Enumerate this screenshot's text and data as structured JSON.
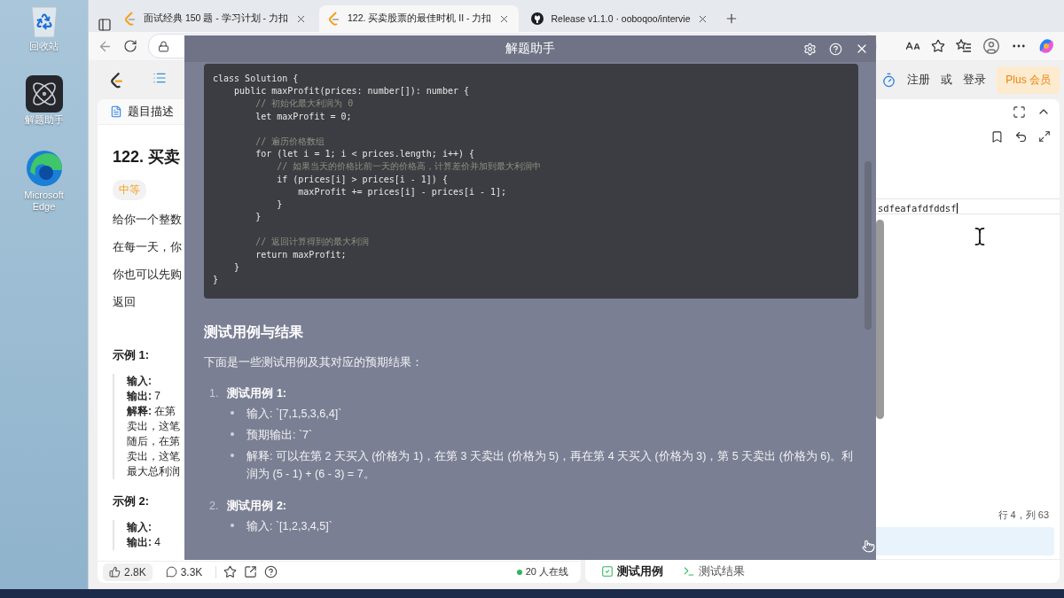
{
  "desktop_icons": [
    {
      "kind": "recycle",
      "label": "回收站"
    },
    {
      "kind": "atom",
      "label": "解题助手"
    },
    {
      "kind": "edge",
      "label": "Microsoft Edge"
    }
  ],
  "browser": {
    "tabs": [
      {
        "kind": "leetcode",
        "title": "面试经典 150 题 - 学习计划 - 力扣",
        "selected": false
      },
      {
        "kind": "leetcode",
        "title": "122. 买卖股票的最佳时机 II - 力扣",
        "selected": true
      },
      {
        "kind": "github",
        "title": "Release v1.1.0 · ooboqoo/intervie",
        "selected": false
      }
    ]
  },
  "header": {
    "register": "注册",
    "or": "或",
    "login": "登录",
    "plus": "Plus 会员"
  },
  "problem": {
    "tab": "题目描述",
    "title": "122. 买卖",
    "difficulty": "中等",
    "paragraphs": [
      "给你一个整数",
      "在每一天，你",
      "你也可以先购",
      "返回"
    ],
    "examples": [
      {
        "heading": "示例 1:",
        "lines": [
          {
            "label": "输入:"
          },
          {
            "label": "输出:",
            "text": "7"
          },
          {
            "label": "解释:",
            "text": "在第"
          },
          {
            "text": "卖出，这笔"
          },
          {
            "text": "随后，在第"
          },
          {
            "text": "卖出，这笔"
          },
          {
            "text": "最大总利润"
          }
        ]
      },
      {
        "heading": "示例 2:",
        "lines": [
          {
            "label": "输入:"
          },
          {
            "label": "输出:",
            "text": "4"
          }
        ]
      }
    ],
    "footer": {
      "likes": "2.8K",
      "comments": "3.3K",
      "online": "20 人在线"
    }
  },
  "editor": {
    "line_text": "sdfeafafdfddsf",
    "position": "行 4，列 63",
    "tabs": [
      {
        "label": "测试用例",
        "selected": true
      },
      {
        "label": "测试结果",
        "selected": false
      }
    ]
  },
  "assistant": {
    "title": "解题助手",
    "code": [
      {
        "kind": "code",
        "text": "class Solution {"
      },
      {
        "kind": "code",
        "text": "    public maxProfit(prices: number[]): number {"
      },
      {
        "kind": "comment",
        "text": "        // 初始化最大利润为 0"
      },
      {
        "kind": "code",
        "text": "        let maxProfit = 0;"
      },
      {
        "kind": "blank"
      },
      {
        "kind": "comment",
        "text": "        // 遍历价格数组"
      },
      {
        "kind": "code",
        "text": "        for (let i = 1; i < prices.length; i++) {"
      },
      {
        "kind": "comment",
        "text": "            // 如果当天的价格比前一天的价格高，计算差价并加到最大利润中"
      },
      {
        "kind": "code",
        "text": "            if (prices[i] > prices[i - 1]) {"
      },
      {
        "kind": "code",
        "text": "                maxProfit += prices[i] - prices[i - 1];"
      },
      {
        "kind": "code",
        "text": "            }"
      },
      {
        "kind": "code",
        "text": "        }"
      },
      {
        "kind": "blank"
      },
      {
        "kind": "comment",
        "text": "        // 返回计算得到的最大利润"
      },
      {
        "kind": "code",
        "text": "        return maxProfit;"
      },
      {
        "kind": "code",
        "text": "    }"
      },
      {
        "kind": "code",
        "text": "}"
      }
    ],
    "section_title": "测试用例与结果",
    "intro": "下面是一些测试用例及其对应的预期结果：",
    "cases": [
      {
        "number": "1.",
        "title": "测试用例 1:",
        "items": [
          "输入: `[7,1,5,3,6,4]`",
          "预期输出: `7`",
          "解释: 可以在第 2 天买入 (价格为 1)，在第 3 天卖出 (价格为 5)，再在第 4 天买入 (价格为 3)，第 5 天卖出 (价格为 6)。利润为 (5 - 1) + (6 - 3) = 7。"
        ]
      },
      {
        "number": "2.",
        "title": "测试用例 2:",
        "items": [
          "输入: `[1,2,3,4,5]`"
        ]
      }
    ]
  }
}
